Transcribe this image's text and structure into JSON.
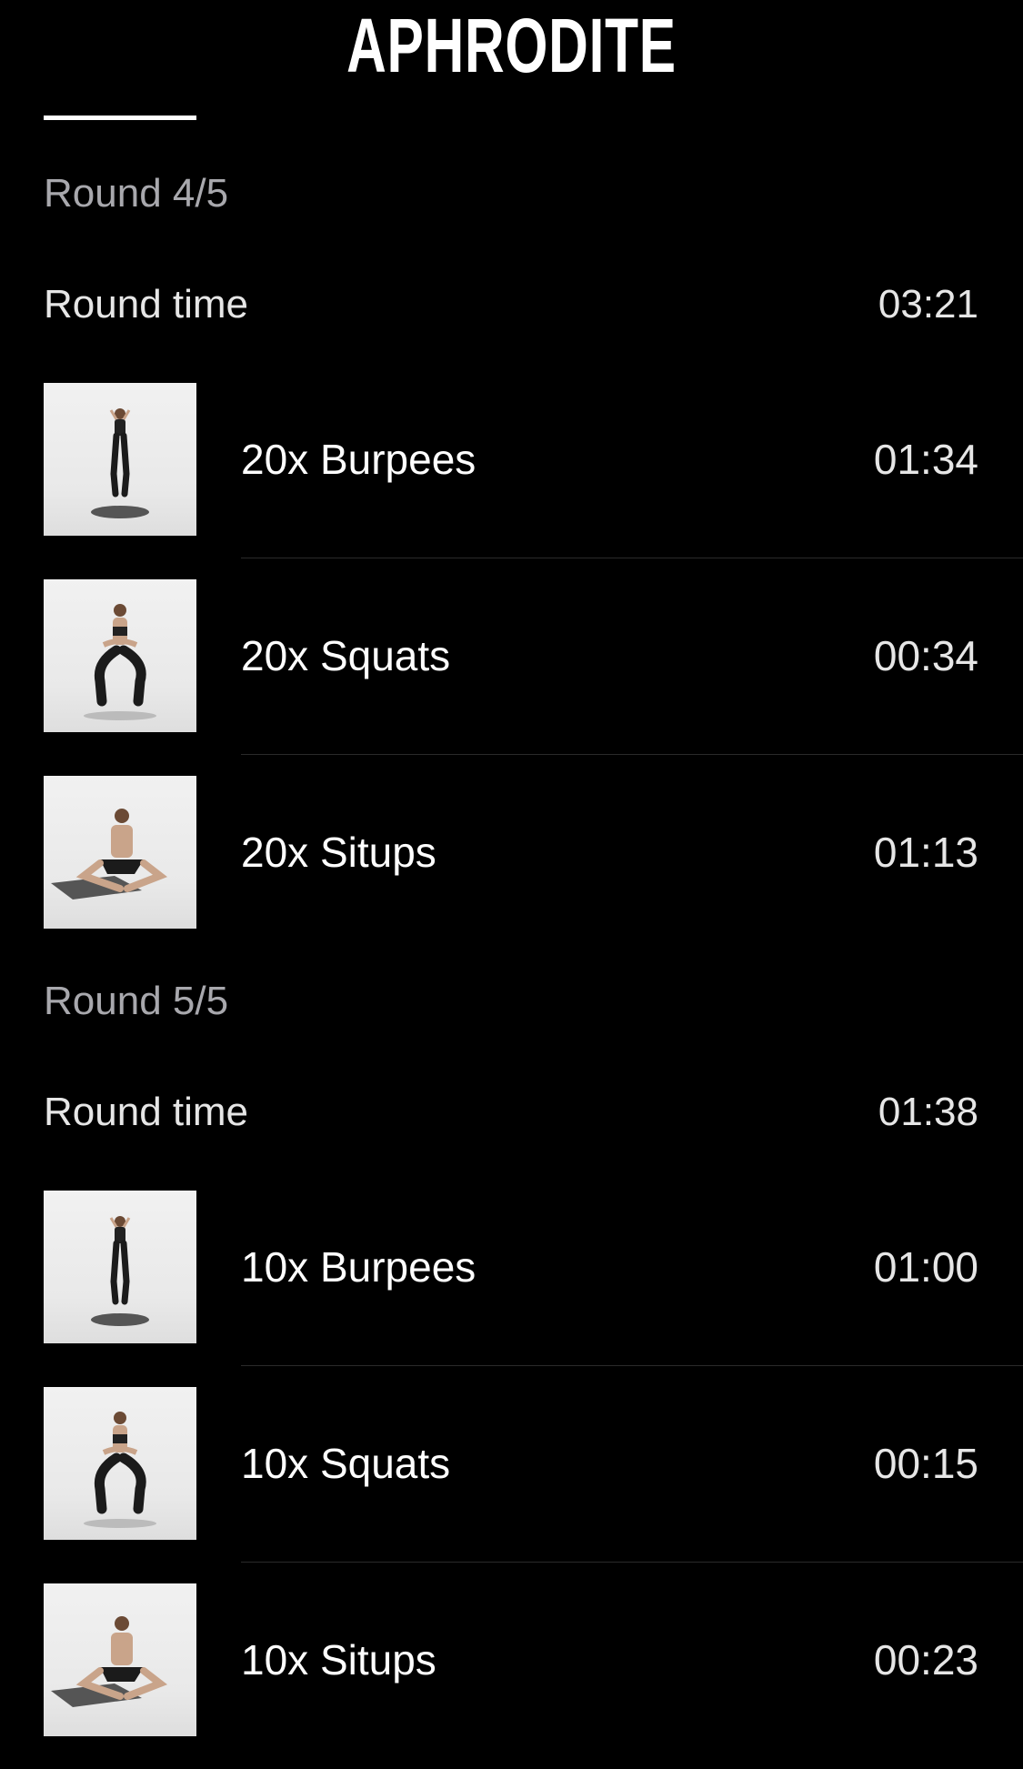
{
  "header": {
    "title": "APHRODITE"
  },
  "rounds": [
    {
      "label": "Round 4/5",
      "round_time_label": "Round time",
      "round_time": "03:21",
      "exercises": [
        {
          "name": "20x Burpees",
          "time": "01:34",
          "thumb_icon": "burpee-pose-icon"
        },
        {
          "name": "20x Squats",
          "time": "00:34",
          "thumb_icon": "squat-pose-icon"
        },
        {
          "name": "20x Situps",
          "time": "01:13",
          "thumb_icon": "situp-pose-icon"
        }
      ]
    },
    {
      "label": "Round 5/5",
      "round_time_label": "Round time",
      "round_time": "01:38",
      "exercises": [
        {
          "name": "10x Burpees",
          "time": "01:00",
          "thumb_icon": "burpee-pose-icon"
        },
        {
          "name": "10x Squats",
          "time": "00:15",
          "thumb_icon": "squat-pose-icon"
        },
        {
          "name": "10x Situps",
          "time": "00:23",
          "thumb_icon": "situp-pose-icon"
        }
      ]
    }
  ],
  "colors": {
    "background": "#000000",
    "text_primary": "#ffffff",
    "text_secondary": "#a8a8ad",
    "divider": "#2a2a2a"
  }
}
